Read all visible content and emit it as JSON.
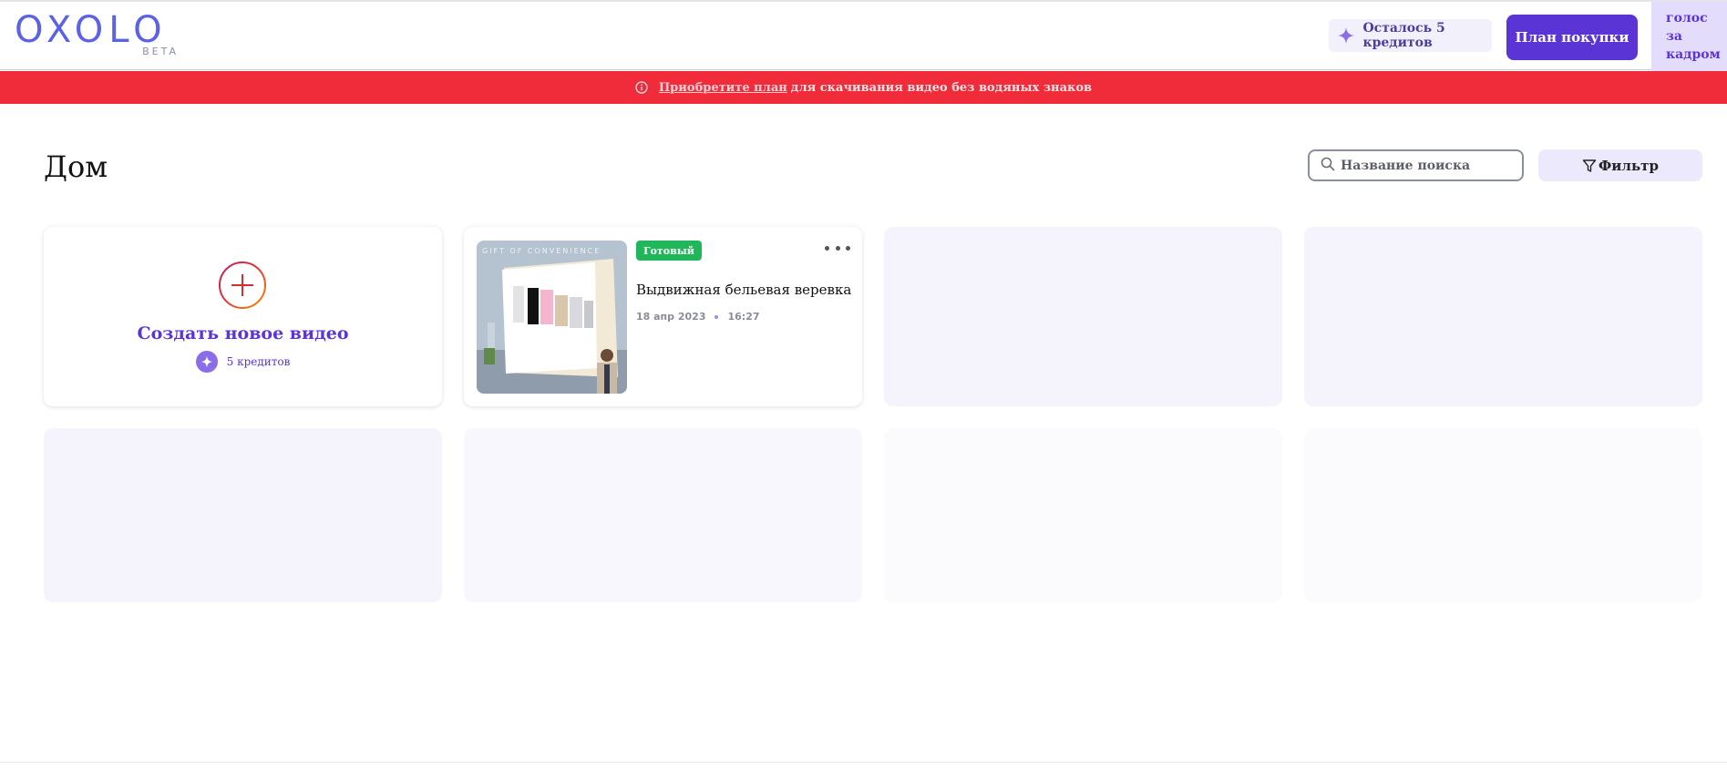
{
  "header": {
    "logo_text": "OXOLO",
    "logo_badge": "BETA",
    "credits_label": "Осталось 5 кредитов",
    "buy_button": "План покупки",
    "voice_tab": "голос за кадром"
  },
  "alert": {
    "link_text": "Приобретите план",
    "message": "для скачивания видео без водяных знаков"
  },
  "page": {
    "title": "Дом",
    "search_placeholder": "Название поиска",
    "filter_label": "Фильтр"
  },
  "create_card": {
    "title": "Создать новое видео",
    "credits": "5 кредитов"
  },
  "video_card": {
    "status": "Готовый",
    "title": "Выдвижная бельевая веревка",
    "date": "18 апр 2023",
    "time": "16:27",
    "thumbnail_caption": "GIFT OF CONVENIENCE"
  },
  "colors": {
    "brand": "#5b34d6",
    "alert": "#f02b3a",
    "ready": "#1fb75a",
    "logo": "#5b63e4"
  },
  "icons": [
    "sparkle-icon",
    "info-icon",
    "search-icon",
    "filter-icon",
    "plus-icon",
    "more-dots-icon"
  ]
}
